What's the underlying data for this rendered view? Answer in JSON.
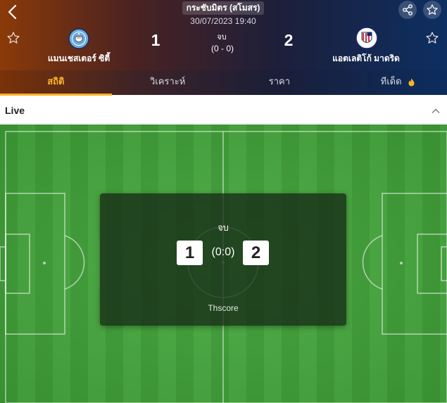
{
  "header": {
    "league": "กระชับมิตร (สโมสร)",
    "match_time": "30/07/2023 19:40",
    "status": "จบ",
    "half_time_score": "(0 - 0)",
    "home": {
      "name": "แมนเชสเตอร์ ซิตี้",
      "score": "1",
      "logo_icon": "man-city-crest"
    },
    "away": {
      "name": "แอตเลติโก้ มาดริด",
      "score": "2",
      "logo_icon": "atletico-crest"
    }
  },
  "tabs": [
    {
      "label": "สถิติ",
      "active": true
    },
    {
      "label": "วิเคราะห์",
      "active": false
    },
    {
      "label": "ราคา",
      "active": false
    },
    {
      "label": "ทีเด็ด",
      "active": false
    }
  ],
  "live": {
    "label": "Live"
  },
  "overlay": {
    "status": "จบ",
    "home_score": "1",
    "away_score": "2",
    "half_time": "(0:0)",
    "brand": "Thscore"
  },
  "colors": {
    "accent": "#ffb324",
    "pitch_green": "#46a73e",
    "header_left": "#8a3a08",
    "header_right": "#0d2f62"
  }
}
